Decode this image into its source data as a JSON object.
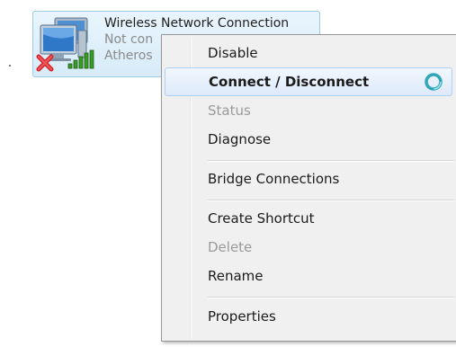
{
  "network_item": {
    "name": "Wireless Network Connection",
    "status": "Not con",
    "device": "Atheros"
  },
  "context_menu": {
    "items": [
      {
        "label": "Disable",
        "enabled": true
      },
      {
        "label": "Connect / Disconnect",
        "enabled": true,
        "default": true,
        "highlighted": true
      },
      {
        "label": "Status",
        "enabled": false
      },
      {
        "label": "Diagnose",
        "enabled": true
      },
      {
        "label": "Bridge Connections",
        "enabled": true
      },
      {
        "label": "Create Shortcut",
        "enabled": true
      },
      {
        "label": "Delete",
        "enabled": false
      },
      {
        "label": "Rename",
        "enabled": true
      },
      {
        "label": "Properties",
        "enabled": true
      }
    ],
    "busy_indicator": "spinner-icon"
  },
  "icons": {
    "network": "wireless-network-icon",
    "error": "red-x-icon",
    "signal": "signal-bars-icon"
  },
  "colors": {
    "selection_fill": "#d7ebf8",
    "selection_border": "#9ccbe6",
    "menu_background": "#f0f0f0",
    "highlight_border": "#aecff7",
    "error_red": "#d6232a",
    "signal_green": "#3a9b28"
  }
}
